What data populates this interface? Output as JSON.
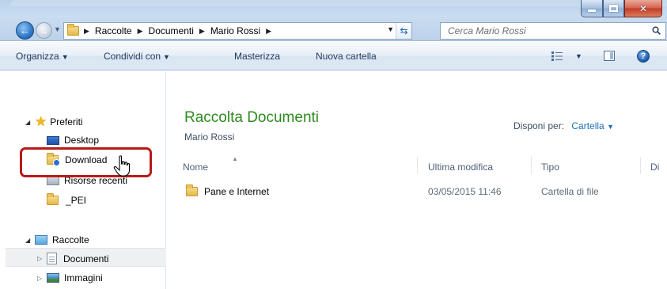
{
  "address_bar": {
    "breadcrumbs": [
      "Raccolte",
      "Documenti",
      "Mario Rossi"
    ]
  },
  "search": {
    "placeholder": "Cerca Mario Rossi"
  },
  "toolbar": {
    "organize": "Organizza",
    "share_with": "Condividi con",
    "burn": "Masterizza",
    "new_folder": "Nuova cartella"
  },
  "navigation_pane": {
    "favorites": {
      "label": "Preferiti",
      "items": [
        "Desktop",
        "Download",
        "Risorse recenti",
        "_PEI"
      ]
    },
    "libraries": {
      "label": "Raccolte",
      "items": [
        "Documenti",
        "Immagini"
      ]
    }
  },
  "library_header": {
    "title": "Raccolta Documenti",
    "subtitle": "Mario Rossi",
    "arrange_by_label": "Disponi per:",
    "arrange_by_value": "Cartella"
  },
  "columns": [
    "Nome",
    "Ultima modifica",
    "Tipo",
    "Di"
  ],
  "files": [
    {
      "name": "Pane e Internet",
      "modified": "03/05/2015 11:46",
      "type": "Cartella di file"
    }
  ],
  "colors": {
    "library_title": "#2e8b1f",
    "highlight_box": "#b81a1a",
    "link": "#1f6fb7"
  }
}
